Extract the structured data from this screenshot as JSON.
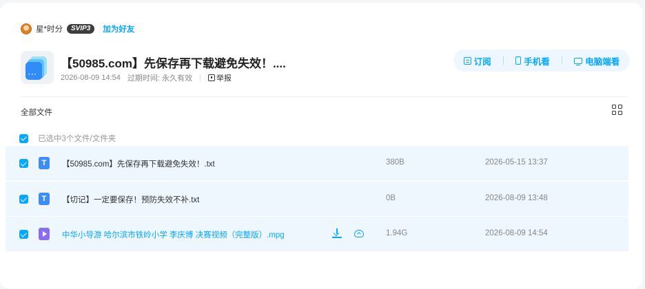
{
  "user": {
    "name": "星*时分",
    "badge": "SVIP3",
    "add_friend": "加为好友"
  },
  "share": {
    "title": "【50985.com】先保存再下载避免失效！....",
    "created": "2026-08-09 14:54",
    "expire_label": "过期时间:",
    "expire_value": "永久有效",
    "report": "举报"
  },
  "actions": {
    "subscribe": "订阅",
    "mobile": "手机看",
    "desktop": "电脑端看"
  },
  "breadcrumb": "全部文件",
  "selection_text": "已选中3个文件/文件夹",
  "files": [
    {
      "type_icon": "T",
      "name": "【50985.com】先保存再下载避免失效！.txt",
      "size": "380B",
      "date": "2026-05-15 13:37",
      "checked": true
    },
    {
      "type_icon": "T",
      "name": "【切记】一定要保存！预防失效不补.txt",
      "size": "0B",
      "date": "2026-08-09 13:48",
      "checked": true
    },
    {
      "type_icon": "video",
      "name": "中华小导游 哈尔滨市铁岭小学 李庆博 决赛视频（完整版）.mpg",
      "size": "1.94G",
      "date": "2026-08-09 14:54",
      "checked": true
    }
  ],
  "colors": {
    "accent": "#06a7ff",
    "row_bg": "#eef6fe",
    "txt_icon": "#3e8df6",
    "video_icon": "#8a6cf2"
  }
}
